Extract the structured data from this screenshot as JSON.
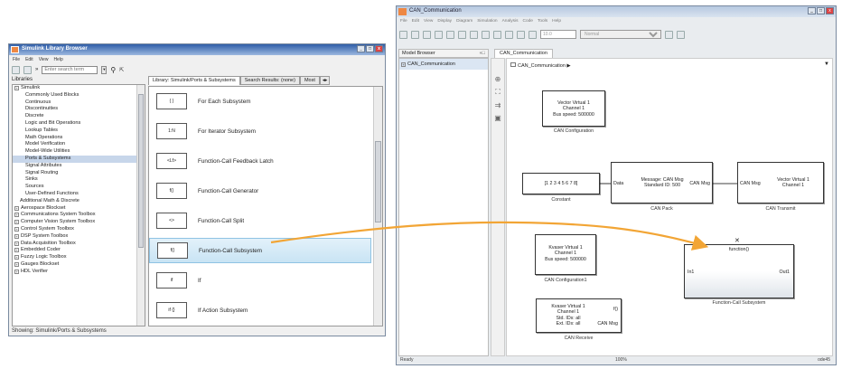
{
  "lib": {
    "title": "Simulink Library Browser",
    "menu": [
      "File",
      "Edit",
      "View",
      "Help"
    ],
    "search_placeholder": "Enter search term",
    "libraries_header": "Libraries",
    "tabs": [
      "Library: Simulink/Ports & Subsystems",
      "Search Results: (none)",
      "Most"
    ],
    "tree": [
      {
        "label": "Simulink",
        "indent": 0,
        "icon": true
      },
      {
        "label": "Commonly Used Blocks",
        "indent": 2
      },
      {
        "label": "Continuous",
        "indent": 2
      },
      {
        "label": "Discontinuities",
        "indent": 2
      },
      {
        "label": "Discrete",
        "indent": 2
      },
      {
        "label": "Logic and Bit Operations",
        "indent": 2
      },
      {
        "label": "Lookup Tables",
        "indent": 2
      },
      {
        "label": "Math Operations",
        "indent": 2
      },
      {
        "label": "Model Verification",
        "indent": 2
      },
      {
        "label": "Model-Wide Utilities",
        "indent": 2
      },
      {
        "label": "Ports & Subsystems",
        "indent": 2,
        "selected": true
      },
      {
        "label": "Signal Attributes",
        "indent": 2
      },
      {
        "label": "Signal Routing",
        "indent": 2
      },
      {
        "label": "Sinks",
        "indent": 2
      },
      {
        "label": "Sources",
        "indent": 2
      },
      {
        "label": "User-Defined Functions",
        "indent": 2
      },
      {
        "label": "Additional Math & Discrete",
        "indent": 1
      },
      {
        "label": "Aerospace Blockset",
        "indent": 0,
        "icon": true
      },
      {
        "label": "Communications System Toolbox",
        "indent": 0,
        "icon": true
      },
      {
        "label": "Computer Vision System Toolbox",
        "indent": 0,
        "icon": true
      },
      {
        "label": "Control System Toolbox",
        "indent": 0,
        "icon": true
      },
      {
        "label": "DSP System Toolbox",
        "indent": 0,
        "icon": true
      },
      {
        "label": "Data Acquisition Toolbox",
        "indent": 0,
        "icon": true
      },
      {
        "label": "Embedded Coder",
        "indent": 0,
        "icon": true
      },
      {
        "label": "Fuzzy Logic Toolbox",
        "indent": 0,
        "icon": true
      },
      {
        "label": "Gauges Blockset",
        "indent": 0,
        "icon": true
      },
      {
        "label": "HDL Verifier",
        "indent": 0,
        "icon": true
      }
    ],
    "blocks": [
      {
        "label": "For Each Subsystem",
        "icon": "{ }"
      },
      {
        "label": "For Iterator Subsystem",
        "icon": "1:N"
      },
      {
        "label": "Function-Call Feedback Latch",
        "icon": "<Lf>"
      },
      {
        "label": "Function-Call Generator",
        "icon": "f()"
      },
      {
        "label": "Function-Call Split",
        "icon": "<>"
      },
      {
        "label": "Function-Call Subsystem",
        "icon": "f()",
        "selected": true
      },
      {
        "label": "If",
        "icon": "if"
      },
      {
        "label": "If Action Subsystem",
        "icon": "if {}"
      }
    ],
    "status": "Showing: Simulink/Ports & Subsystems"
  },
  "model": {
    "title": "CAN_Communication",
    "menu": [
      "File",
      "Edit",
      "View",
      "Display",
      "Diagram",
      "Simulation",
      "Analysis",
      "Code",
      "Tools",
      "Help"
    ],
    "stop_time": "10.0",
    "sim_mode": "Normal",
    "model_browser": "Model Browser",
    "tree_root": "CAN_Communication",
    "tab": "CAN_Communication",
    "breadcrumb": "CAN_Communication ▶",
    "blocks": {
      "can_config": {
        "text": "Vector Virtual 1\nChannel 1\nBus speed: 500000",
        "label": "CAN Configuration"
      },
      "constant": {
        "text": "[1 2 3 4 5 6 7 8]",
        "label": "Constant"
      },
      "can_pack": {
        "text": "Message: CAN Msg\nStandard ID: 500",
        "in": "Data",
        "out": "CAN Msg",
        "label": "CAN Pack"
      },
      "can_transmit": {
        "text": "Vector Virtual 1\nChannel 1",
        "in": "CAN Msg",
        "label": "CAN Transmit"
      },
      "can_config1": {
        "text": "Kvaser Virtual 1\nChannel 1\nBus speed: 500000",
        "label": "CAN Configuration1"
      },
      "fcs": {
        "text": "function()",
        "in": "In1",
        "out": "Out1",
        "label": "Function-Call Subsystem"
      },
      "can_receive": {
        "text": "Kvaser Virtual 1\nChannel 1\nStd. IDs: all\nExt. IDs: all",
        "out1": "f()",
        "out2": "CAN Msg",
        "label": "CAN Receive"
      }
    },
    "status_left": "Ready",
    "status_mid": "100%",
    "status_right": "ode45"
  },
  "colors": {
    "arrow": "#f2a535",
    "selection": "#c9e4f4"
  }
}
